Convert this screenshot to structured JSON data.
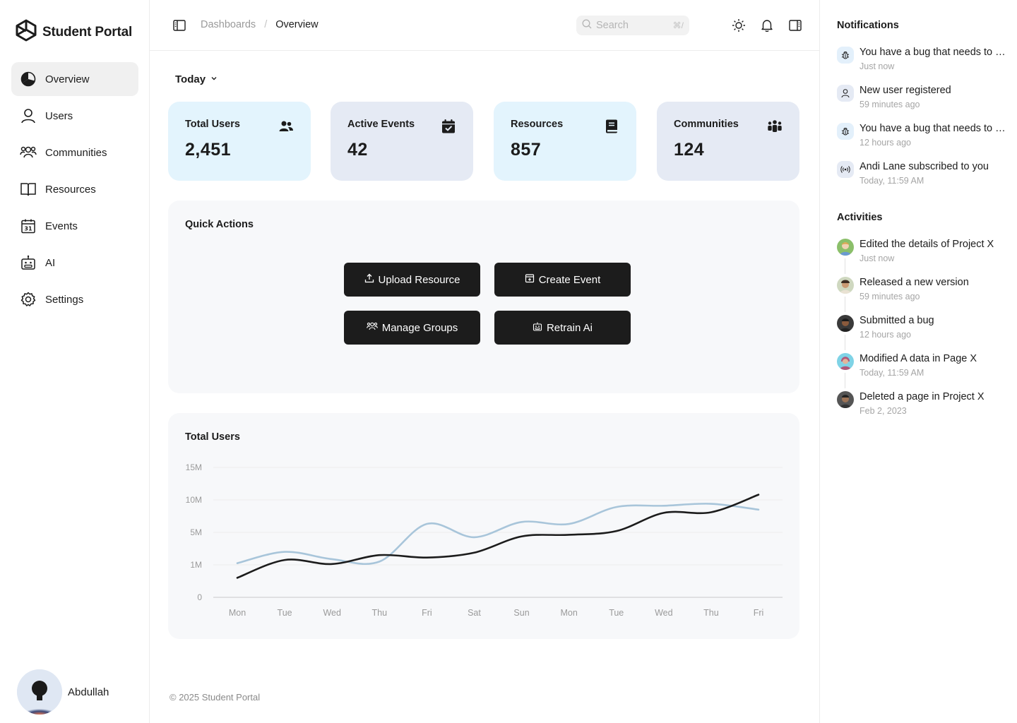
{
  "app": {
    "title": "Student Portal"
  },
  "sidebar": {
    "items": [
      {
        "label": "Overview",
        "icon": "pie-chart-icon",
        "active": true
      },
      {
        "label": "Users",
        "icon": "user-icon"
      },
      {
        "label": "Communities",
        "icon": "users-group-icon"
      },
      {
        "label": "Resources",
        "icon": "book-open-icon"
      },
      {
        "label": "Events",
        "icon": "calendar-icon"
      },
      {
        "label": "AI",
        "icon": "robot-icon"
      },
      {
        "label": "Settings",
        "icon": "gear-icon"
      }
    ],
    "user": {
      "name": "Abdullah"
    }
  },
  "header": {
    "breadcrumb": [
      "Dashboards",
      "/",
      "Overview"
    ],
    "search": {
      "placeholder": "Search",
      "shortcut": "⌘/"
    }
  },
  "main": {
    "range_label": "Today",
    "stats": [
      {
        "label": "Total Users",
        "value": "2,451",
        "icon": "users-icon"
      },
      {
        "label": "Active Events",
        "value": "42",
        "icon": "calendar-check-icon"
      },
      {
        "label": "Resources",
        "value": "857",
        "icon": "book-icon"
      },
      {
        "label": "Communities",
        "value": "124",
        "icon": "people-group-icon"
      }
    ],
    "quick_actions": {
      "title": "Quick Actions",
      "buttons": [
        {
          "label": "Upload Resource",
          "icon": "upload-icon"
        },
        {
          "label": "Create Event",
          "icon": "calendar-plus-icon"
        },
        {
          "label": "Manage Groups",
          "icon": "users-group-icon"
        },
        {
          "label": "Retrain Ai",
          "icon": "robot-icon"
        }
      ]
    },
    "chart_title": "Total Users",
    "footer": "© 2025 Student Portal"
  },
  "chart_data": {
    "type": "line",
    "title": "Total Users",
    "categories": [
      "Mon",
      "Tue",
      "Wed",
      "Thu",
      "Fri",
      "Sat",
      "Sun",
      "Mon",
      "Tue",
      "Wed",
      "Thu",
      "Fri"
    ],
    "y_ticks": [
      "0",
      "1M",
      "5M",
      "10M",
      "15M"
    ],
    "series": [
      {
        "color": "#1c1c1c",
        "values": [
          0.6,
          1.6,
          1.1,
          2.2,
          1.9,
          2.5,
          4.5,
          4.7,
          5.2,
          8.0,
          8.1,
          10.8
        ]
      },
      {
        "color": "#a8c5da",
        "values": [
          1.2,
          2.6,
          1.7,
          1.4,
          6.3,
          4.4,
          6.6,
          6.3,
          8.9,
          9.1,
          9.4,
          8.5
        ]
      }
    ],
    "grid": true
  },
  "notifications": {
    "title": "Notifications",
    "items": [
      {
        "text": "You have a bug that needs to be fixed",
        "time": "Just now",
        "icon": "bug-icon"
      },
      {
        "text": "New user registered",
        "time": "59 minutes ago",
        "icon": "user-icon"
      },
      {
        "text": "You have a bug that needs to be fixed",
        "time": "12 hours ago",
        "icon": "bug-icon"
      },
      {
        "text": "Andi Lane subscribed to you",
        "time": "Today, 11:59 AM",
        "icon": "broadcast-icon"
      }
    ]
  },
  "activities": {
    "title": "Activities",
    "items": [
      {
        "text": "Edited the details of Project X",
        "time": "Just now",
        "avatar_color": "#8bbf6a"
      },
      {
        "text": "Released a new version",
        "time": "59 minutes ago",
        "avatar_color": "#c9a47a"
      },
      {
        "text": "Submitted a bug",
        "time": "12 hours ago",
        "avatar_color": "#3a3a3a"
      },
      {
        "text": "Modified A data in Page X",
        "time": "Today, 11:59 AM",
        "avatar_color": "#7fd3e6"
      },
      {
        "text": "Deleted a page in Project X",
        "time": "Feb 2, 2023",
        "avatar_color": "#555555"
      }
    ]
  }
}
